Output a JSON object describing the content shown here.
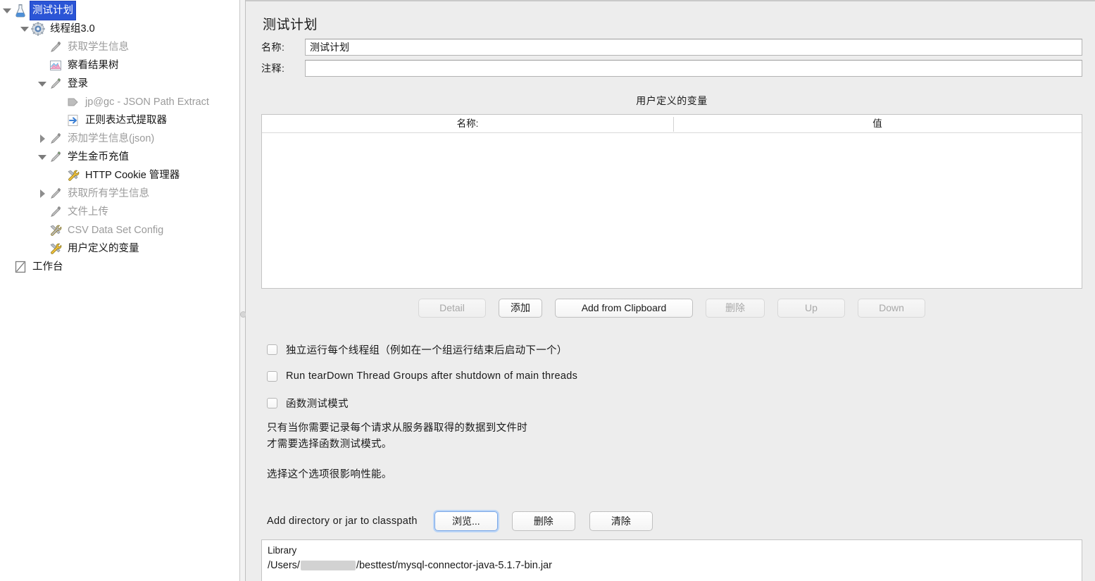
{
  "tree": {
    "items": [
      {
        "label": "测试计划",
        "icon": "flask-icon",
        "depth": 0,
        "toggle": "down",
        "selected": true,
        "enabled": true
      },
      {
        "label": "线程组3.0",
        "icon": "gear-icon",
        "depth": 1,
        "toggle": "down",
        "selected": false,
        "enabled": true
      },
      {
        "label": "获取学生信息",
        "icon": "sampler-pencil-icon",
        "depth": 2,
        "toggle": "none",
        "selected": false,
        "enabled": false
      },
      {
        "label": "察看结果树",
        "icon": "view-results-tree-icon",
        "depth": 2,
        "toggle": "none",
        "selected": false,
        "enabled": true
      },
      {
        "label": "登录",
        "icon": "sampler-pencil-icon",
        "depth": 2,
        "toggle": "down",
        "selected": false,
        "enabled": true
      },
      {
        "label": "jp@gc - JSON Path Extract",
        "icon": "post-processor-arrow-icon",
        "depth": 3,
        "toggle": "none",
        "selected": false,
        "enabled": false
      },
      {
        "label": "正则表达式提取器",
        "icon": "regex-extractor-icon",
        "depth": 3,
        "toggle": "none",
        "selected": false,
        "enabled": true
      },
      {
        "label": "添加学生信息(json)",
        "icon": "sampler-pencil-icon",
        "depth": 2,
        "toggle": "right",
        "selected": false,
        "enabled": false
      },
      {
        "label": "学生金币充值",
        "icon": "sampler-pencil-icon",
        "depth": 2,
        "toggle": "down",
        "selected": false,
        "enabled": true
      },
      {
        "label": "HTTP Cookie 管理器",
        "icon": "config-wrench-icon",
        "depth": 3,
        "toggle": "none",
        "selected": false,
        "enabled": true
      },
      {
        "label": "获取所有学生信息",
        "icon": "sampler-pencil-icon",
        "depth": 2,
        "toggle": "right",
        "selected": false,
        "enabled": false
      },
      {
        "label": "文件上传",
        "icon": "sampler-pencil-icon",
        "depth": 2,
        "toggle": "none",
        "selected": false,
        "enabled": false
      },
      {
        "label": "CSV Data Set Config",
        "icon": "config-wrench-icon",
        "depth": 2,
        "toggle": "none",
        "selected": false,
        "enabled": false
      },
      {
        "label": "用户定义的变量",
        "icon": "config-wrench-icon",
        "depth": 2,
        "toggle": "none",
        "selected": false,
        "enabled": true
      },
      {
        "label": "工作台",
        "icon": "workbench-icon",
        "depth": 0,
        "toggle": "none",
        "selected": false,
        "enabled": true
      }
    ]
  },
  "panel": {
    "title": "测试计划",
    "name_label": "名称:",
    "name_value": "测试计划",
    "comment_label": "注释:",
    "comment_value": "",
    "variables_section_title": "用户定义的变量",
    "table": {
      "columns": [
        "名称:",
        "值"
      ],
      "rows": []
    },
    "buttons": [
      {
        "label": "Detail",
        "enabled": false,
        "size": "det"
      },
      {
        "label": "添加",
        "enabled": true,
        "size": "norm"
      },
      {
        "label": "Add from Clipboard",
        "enabled": true,
        "size": "wide"
      },
      {
        "label": "删除",
        "enabled": false,
        "size": "del"
      },
      {
        "label": "Up",
        "enabled": false,
        "size": "up"
      },
      {
        "label": "Down",
        "enabled": false,
        "size": "up"
      }
    ],
    "checkboxes": [
      {
        "label": "独立运行每个线程组（例如在一个组运行结束后启动下一个）",
        "checked": false
      },
      {
        "label": "Run tearDown Thread Groups after shutdown of main threads",
        "checked": false
      },
      {
        "label": "函数测试模式",
        "checked": false
      }
    ],
    "help_line1": "只有当你需要记录每个请求从服务器取得的数据到文件时",
    "help_line2": "才需要选择函数测试模式。",
    "help_line3": "选择这个选项很影响性能。",
    "classpath": {
      "label": "Add directory or jar to classpath",
      "browse_label": "浏览...",
      "delete_label": "删除",
      "clear_label": "清除"
    },
    "library": {
      "header": "Library",
      "path_prefix": "/Users/",
      "path_suffix": "/besttest/mysql-connector-java-5.1.7-bin.jar"
    }
  },
  "colors": {
    "selection": "#2b55d6",
    "panel_bg": "#ededed",
    "tree_bg": "#ffffff",
    "disabled_text": "#9b9b9b"
  }
}
